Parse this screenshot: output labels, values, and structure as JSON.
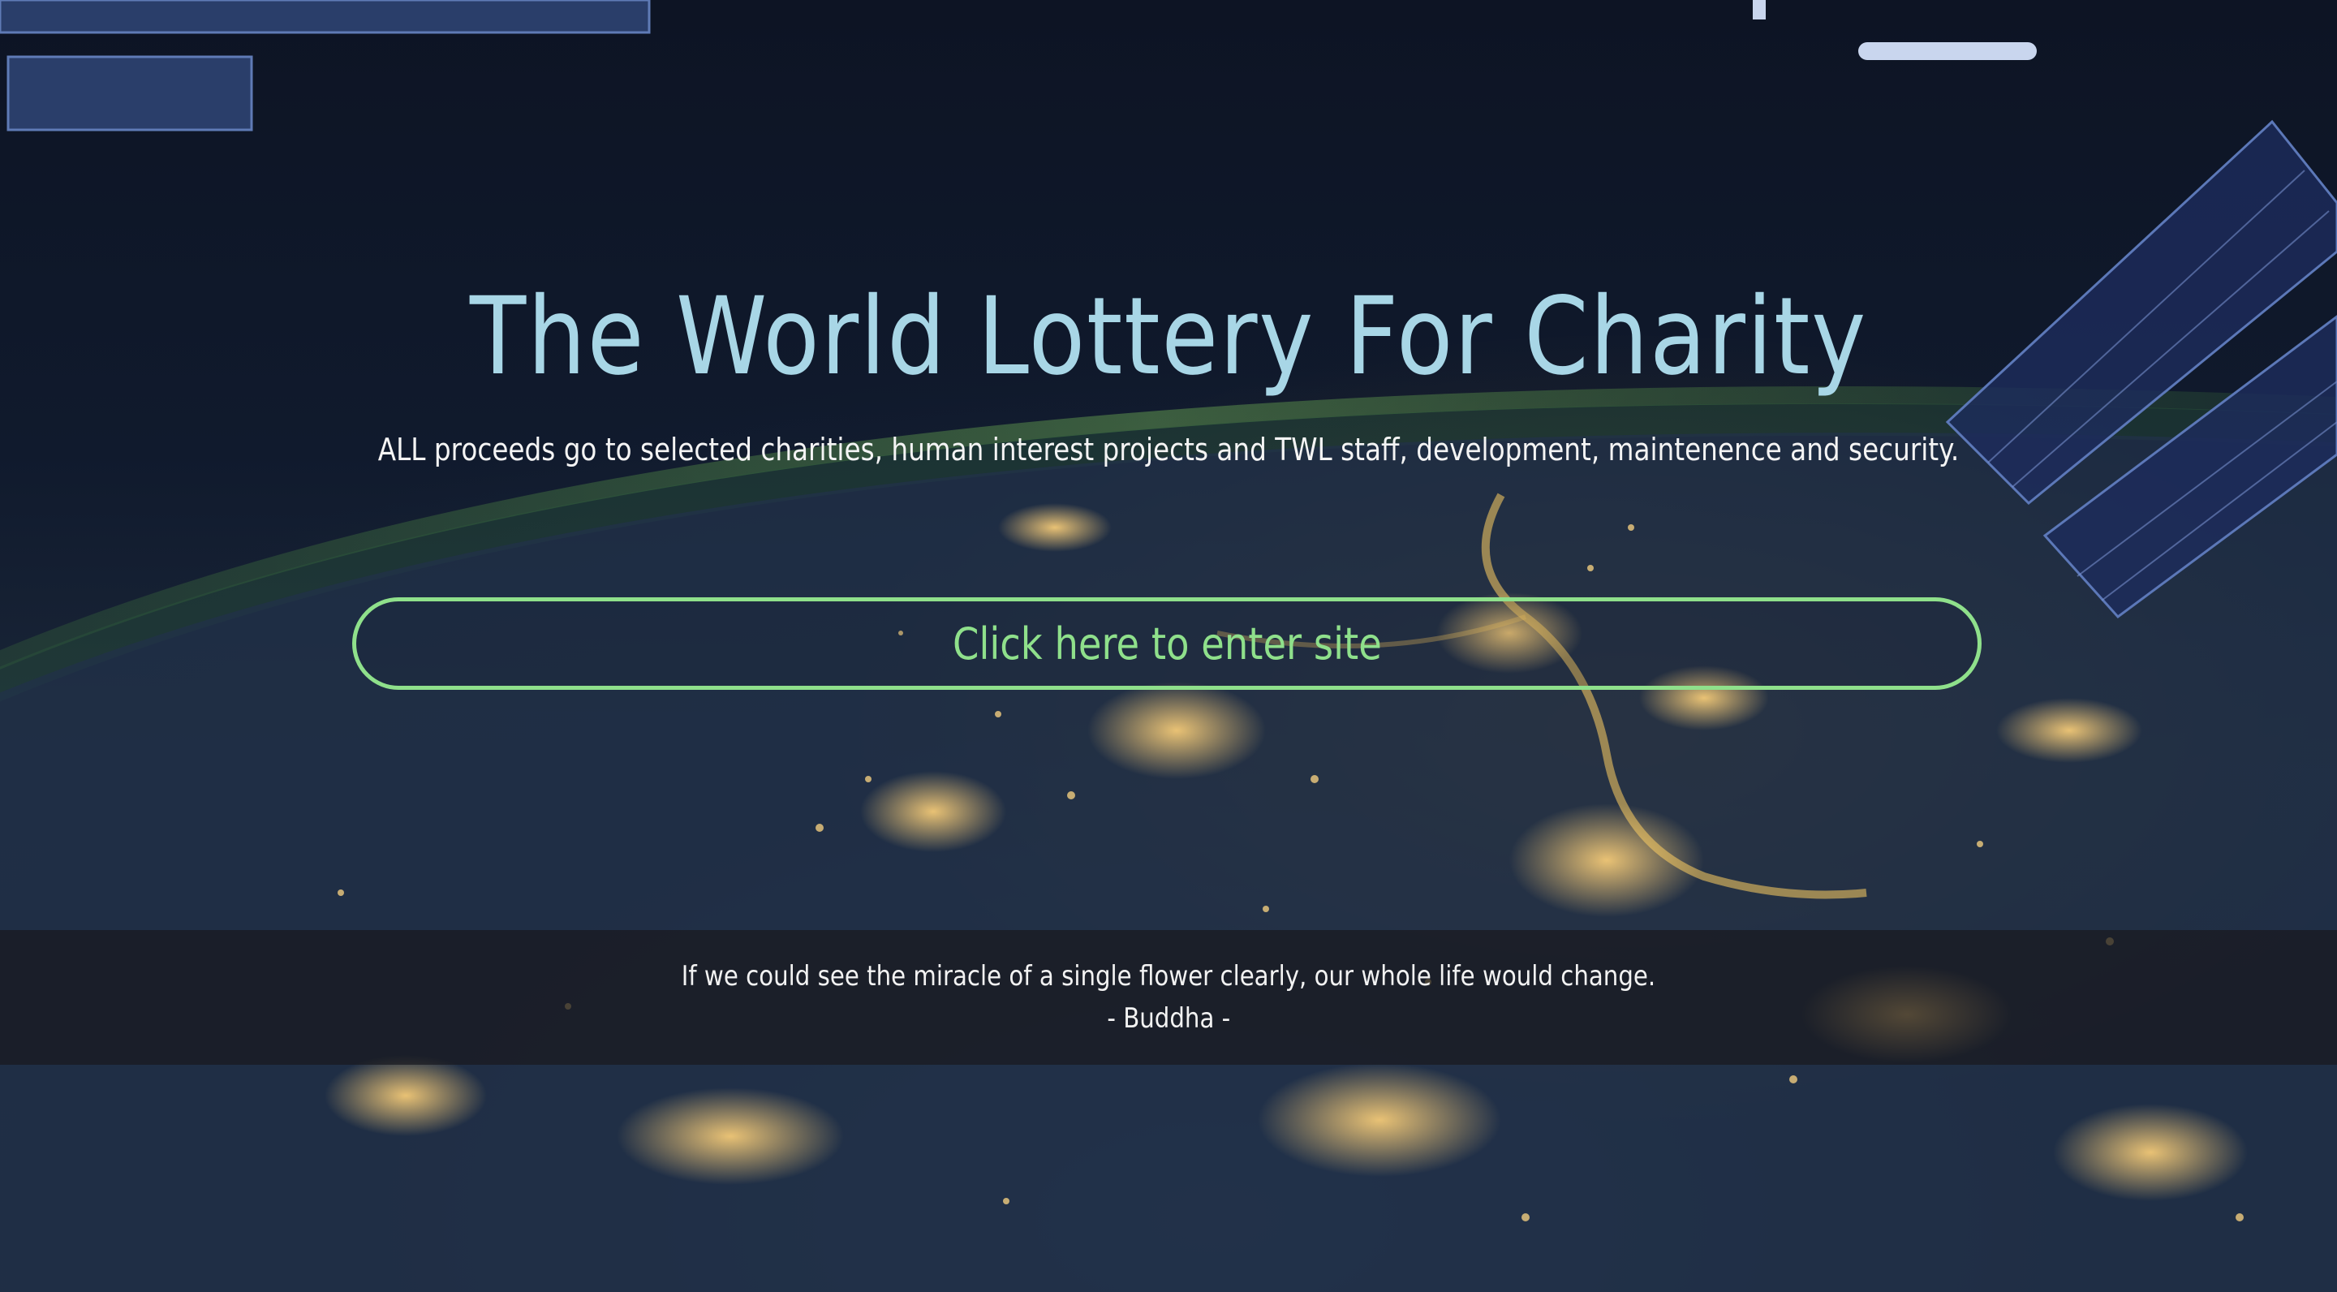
{
  "hero": {
    "title": "The World Lottery For Charity",
    "subtitle": "ALL proceeds go to selected charities, human interest projects and TWL staff, development, maintenence and security."
  },
  "cta": {
    "label": "Click here to enter site"
  },
  "quote": {
    "text": "If we could see the miracle of a single flower clearly, our whole life would change.",
    "author": "- Buddha -"
  },
  "colors": {
    "title": "#a8d6e6",
    "accent_green": "#8fe08b",
    "background": "#0e1626"
  },
  "icons": {
    "background": "earth-at-night-from-space-station"
  }
}
